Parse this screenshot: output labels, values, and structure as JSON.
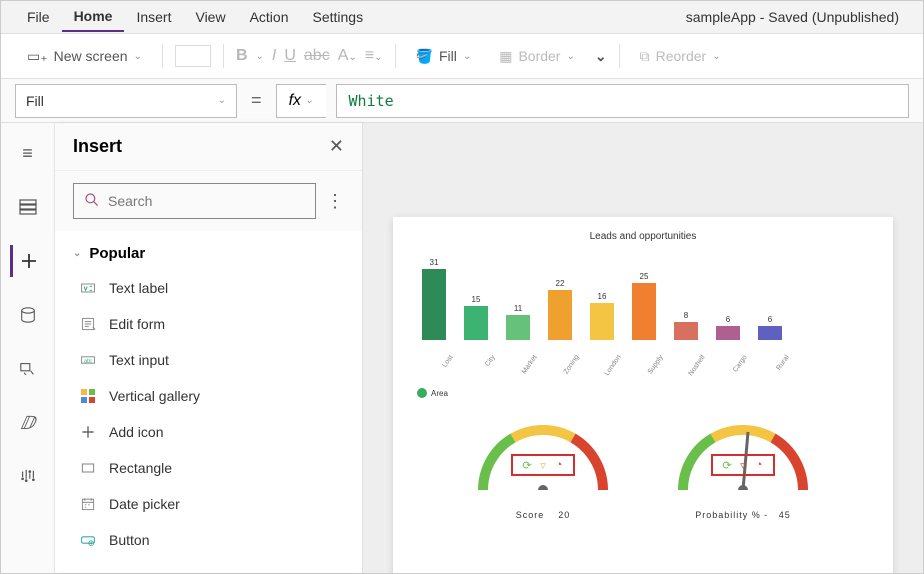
{
  "menubar": {
    "items": [
      "File",
      "Home",
      "Insert",
      "View",
      "Action",
      "Settings"
    ],
    "status": "sampleApp - Saved (Unpublished)"
  },
  "toolbar": {
    "newScreen": "New screen",
    "fill": "Fill",
    "border": "Border",
    "reorder": "Reorder"
  },
  "formulaBar": {
    "property": "Fill",
    "value": "White"
  },
  "insertPane": {
    "title": "Insert",
    "searchPlaceholder": "Search",
    "groupName": "Popular",
    "items": [
      {
        "label": "Text label",
        "icon": "label"
      },
      {
        "label": "Edit form",
        "icon": "form"
      },
      {
        "label": "Text input",
        "icon": "input"
      },
      {
        "label": "Vertical gallery",
        "icon": "gallery"
      },
      {
        "label": "Add icon",
        "icon": "plus"
      },
      {
        "label": "Rectangle",
        "icon": "rect"
      },
      {
        "label": "Date picker",
        "icon": "date"
      },
      {
        "label": "Button",
        "icon": "button"
      }
    ]
  },
  "canvas": {
    "chartTitle": "Leads and opportunities",
    "legend": "Area",
    "gauge1": {
      "label": "Score",
      "value": 20
    },
    "gauge2": {
      "label": "Probability %  -",
      "value": 45
    }
  },
  "chart_data": {
    "type": "bar",
    "title": "Leads and opportunities",
    "categories": [
      "Lost",
      "City",
      "Market",
      "Zoning",
      "London",
      "Supply",
      "Noshelf",
      "Cargo",
      "Rural"
    ],
    "values": [
      31,
      15,
      11,
      22,
      16,
      25,
      8,
      6,
      6
    ],
    "colors": [
      "#2e8b57",
      "#3cb371",
      "#66c17a",
      "#f0a02e",
      "#f4c542",
      "#f08030",
      "#d87060",
      "#b06090",
      "#6060c0"
    ],
    "legend": "Area",
    "ylim": [
      0,
      35
    ]
  }
}
